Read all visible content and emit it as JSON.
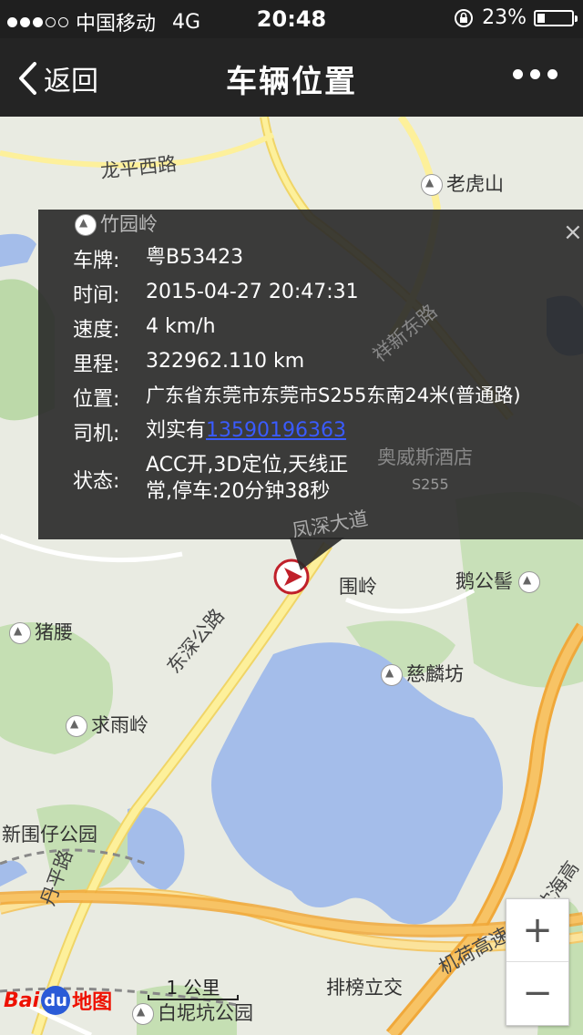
{
  "status": {
    "carrier": "中国移动",
    "network": "4G",
    "time": "20:48",
    "battery_text": "23%",
    "battery_level": 0.23,
    "signal_filled": 3,
    "signal_total": 5
  },
  "nav": {
    "back_label": "返回",
    "title": "车辆位置"
  },
  "popup": {
    "plate_key": "车牌:",
    "plate_value": "粤B53423",
    "time_key": "时间:",
    "time_value": "2015-04-27 20:47:31",
    "speed_key": "速度:",
    "speed_value": "4 km/h",
    "mileage_key": "里程:",
    "mileage_value": "322962.110 km",
    "location_key": "位置:",
    "location_value": "广东省东莞市东莞市S255东南24米(普通路)",
    "driver_key": "司机:",
    "driver_name": "刘实有",
    "driver_phone": "13590196363",
    "state_key": "状态:",
    "state_value": "ACC开,3D定位,天线正常,停车:20分钟38秒",
    "close": "×"
  },
  "map": {
    "labels": {
      "longping": "龙平西路",
      "laohushan": "老虎山",
      "zhuyuanling": "竹园岭",
      "weiling": "围岭",
      "egongji": "鹅公髻",
      "zhuyao": "猪腰",
      "dongshen": "东深公路",
      "cilinfang": "慈麟坊",
      "qiuyuling": "求雨岭",
      "xinweizai": "新围仔公园",
      "danping": "丹平路",
      "paibang": "排榜立交",
      "jihe": "机荷高速",
      "baiyikeng": "白坭坑公园",
      "fengshen": "凤深大道",
      "aowei": "奥威斯酒店",
      "s255": "S255",
      "xiangxin": "祥新东路",
      "yandao": "道",
      "shenzhen_fragment": "深",
      "yanhe_fragment": "沈海高",
      "scale": "1 公里"
    }
  },
  "zoom": {
    "in": "+",
    "out": "−"
  },
  "logo": {
    "bai": "Bai",
    "du": "du",
    "ditu": "地图"
  }
}
